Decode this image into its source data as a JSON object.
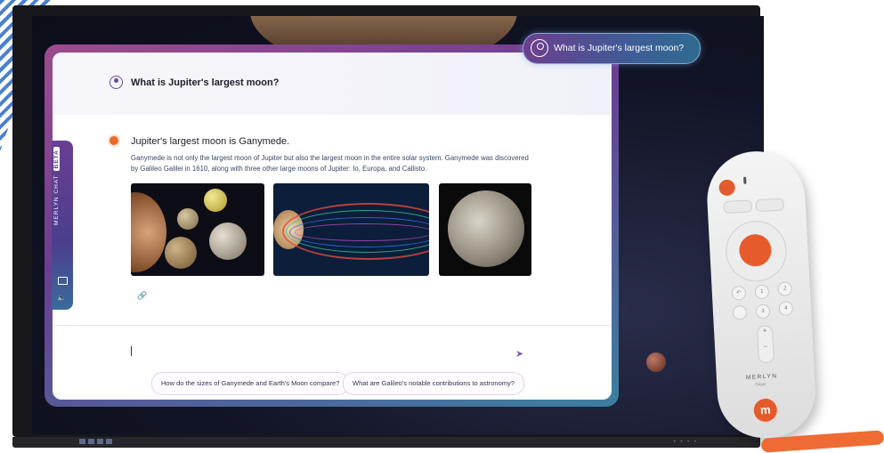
{
  "question_bubble": {
    "text": "What is Jupiter's largest moon?"
  },
  "chat": {
    "question": "What is Jupiter's largest moon?",
    "answer_title": "Jupiter's largest moon is Ganymede.",
    "answer_body": "Ganymede is not only the largest moon of Jupiter but also the largest moon in the entire solar system. Ganymede was discovered by Galileo Galilei in 1610, along with three other large moons of Jupiter: Io, Europa, and Callisto.",
    "input_value": "",
    "suggestions": [
      "How do the sizes of Ganymede and Earth's Moon compare?",
      "What are Galileo's notable contributions to astronomy?"
    ]
  },
  "sidetab": {
    "label": "MERLYN CHAT",
    "badge": "BETA"
  },
  "remote": {
    "brand": "MERLYN",
    "sub": "Origin",
    "logo": "m"
  },
  "colors": {
    "accent": "#6a3e93",
    "orange": "#e65b2c",
    "teal": "#3a6b9c"
  },
  "icons": [
    "user-icon",
    "link-icon",
    "send-icon",
    "screen-share-icon",
    "speaker-icon"
  ]
}
